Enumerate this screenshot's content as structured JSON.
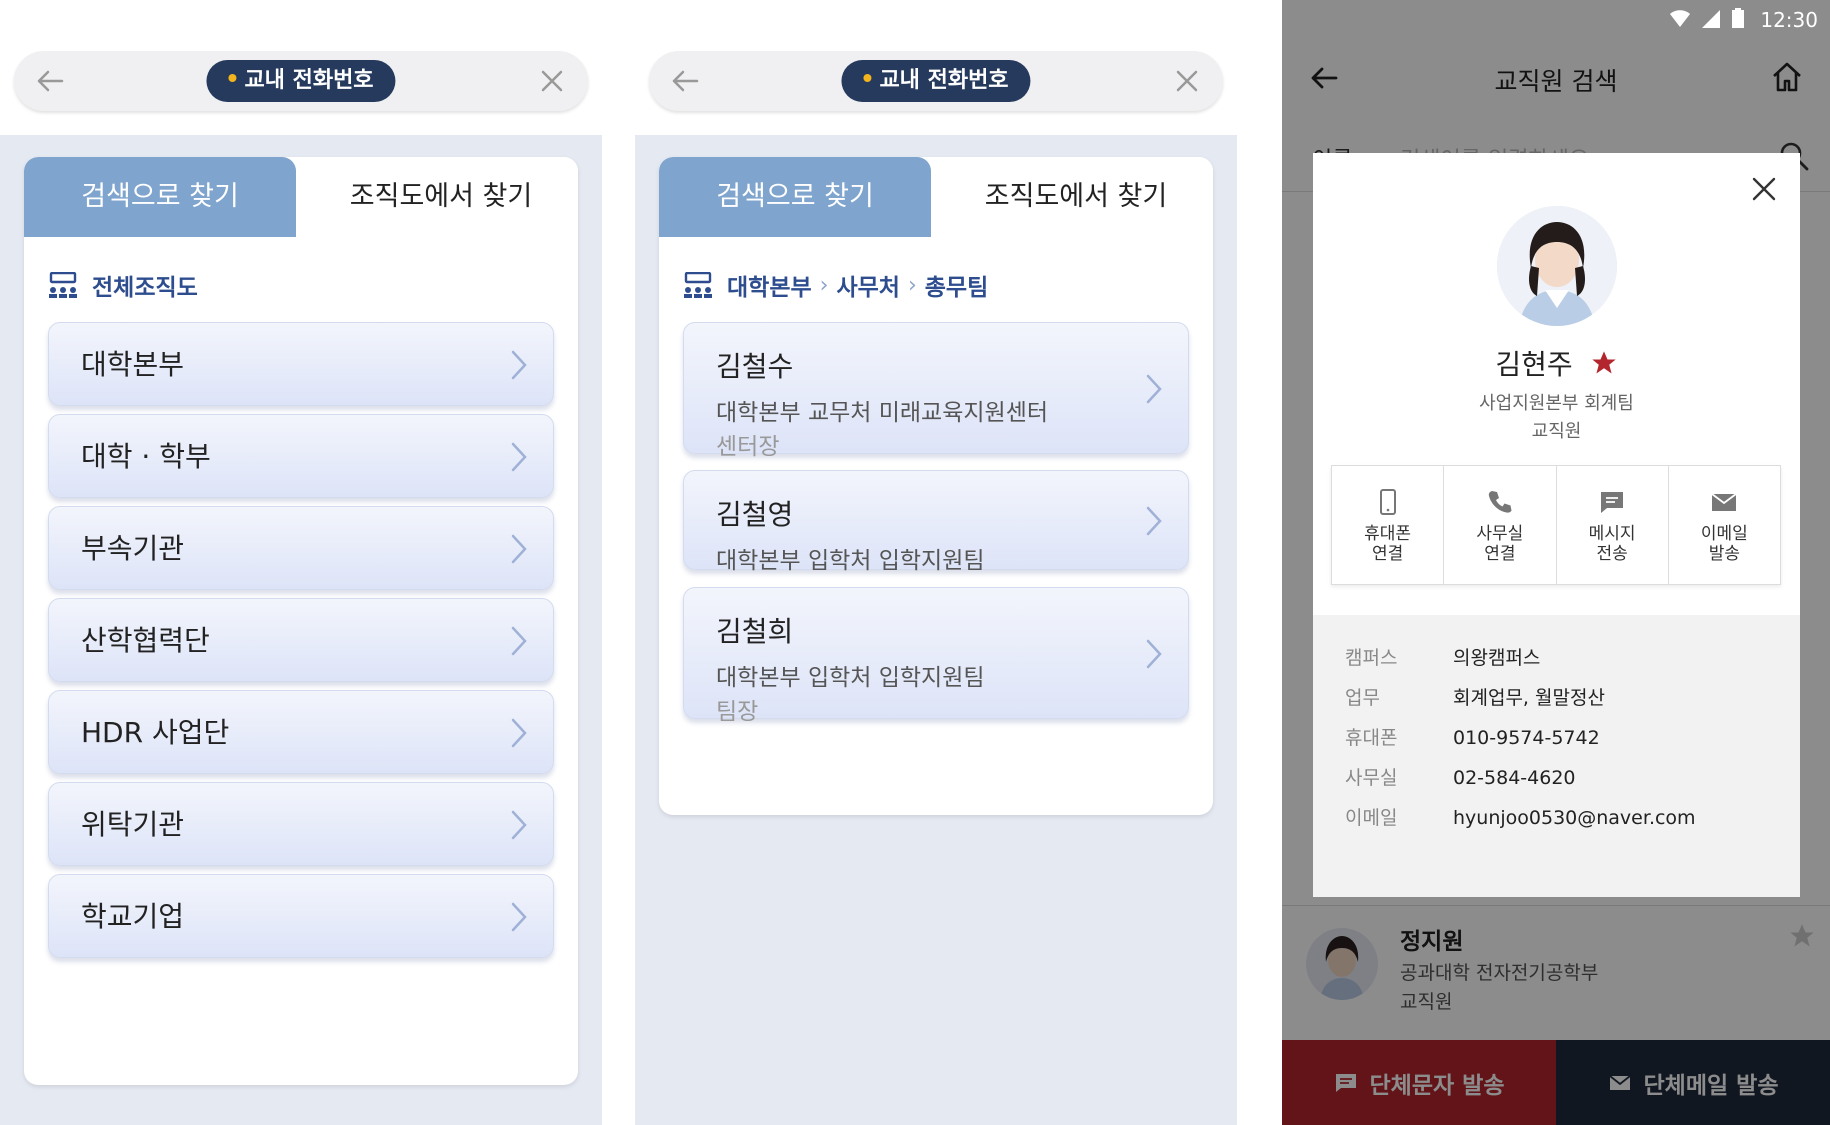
{
  "panel1": {
    "search_chip": "교내 전화번호",
    "tab_search": "검색으로 찾기",
    "tab_org": "조직도에서 찾기",
    "crumb": "전체조직도",
    "items": [
      "대학본부",
      "대학 · 학부",
      "부속기관",
      "산학협력단",
      "HDR 사업단",
      "위탁기관",
      "학교기업"
    ]
  },
  "panel2": {
    "search_chip": "교내 전화번호",
    "tab_search": "검색으로 찾기",
    "tab_org": "조직도에서 찾기",
    "crumb": [
      "대학본부",
      "사무처",
      "총무팀"
    ],
    "people": [
      {
        "name": "김철수",
        "dept": "대학본부 교무처 미래교육지원센터",
        "role": "센터장"
      },
      {
        "name": "김철영",
        "dept": "대학본부 입학처 입학지원팀",
        "role": ""
      },
      {
        "name": "김철희",
        "dept": "대학본부 입학처 입학지원팀",
        "role": "팀장"
      }
    ]
  },
  "phone": {
    "time": "12:30",
    "title": "교직원 검색",
    "search_label": "이름",
    "search_placeholder": "검색어를 입력하세요",
    "modal": {
      "name": "김현주",
      "dept": "사업지원본부 회계팀",
      "role": "교직원",
      "actions": [
        {
          "line1": "휴대폰",
          "line2": "연결",
          "icon": "mobile-phone-icon"
        },
        {
          "line1": "사무실",
          "line2": "연결",
          "icon": "phone-icon"
        },
        {
          "line1": "메시지",
          "line2": "전송",
          "icon": "message-icon"
        },
        {
          "line1": "이메일",
          "line2": "발송",
          "icon": "mail-icon"
        }
      ],
      "info": [
        {
          "key": "캠퍼스",
          "value": "의왕캠퍼스"
        },
        {
          "key": "업무",
          "value": "회계업무, 월말정산"
        },
        {
          "key": "휴대폰",
          "value": "010-9574-5742"
        },
        {
          "key": "사무실",
          "value": "02-584-4620"
        },
        {
          "key": "이메일",
          "value": "hyunjoo0530@naver.com"
        }
      ]
    },
    "list_item": {
      "name": "정지원",
      "dept": "공과대학 전자전기공학부",
      "role": "교직원"
    },
    "btn_sms": "단체문자 발송",
    "btn_mail": "단체메일 발송"
  },
  "colors": {
    "navy": "#263a5e",
    "tab_blue": "#7fa4cd",
    "crumb_blue": "#2d4d8f",
    "star_red": "#b3262d",
    "bottom_red": "#b3262d",
    "bottom_dark": "#1e2a3d"
  }
}
